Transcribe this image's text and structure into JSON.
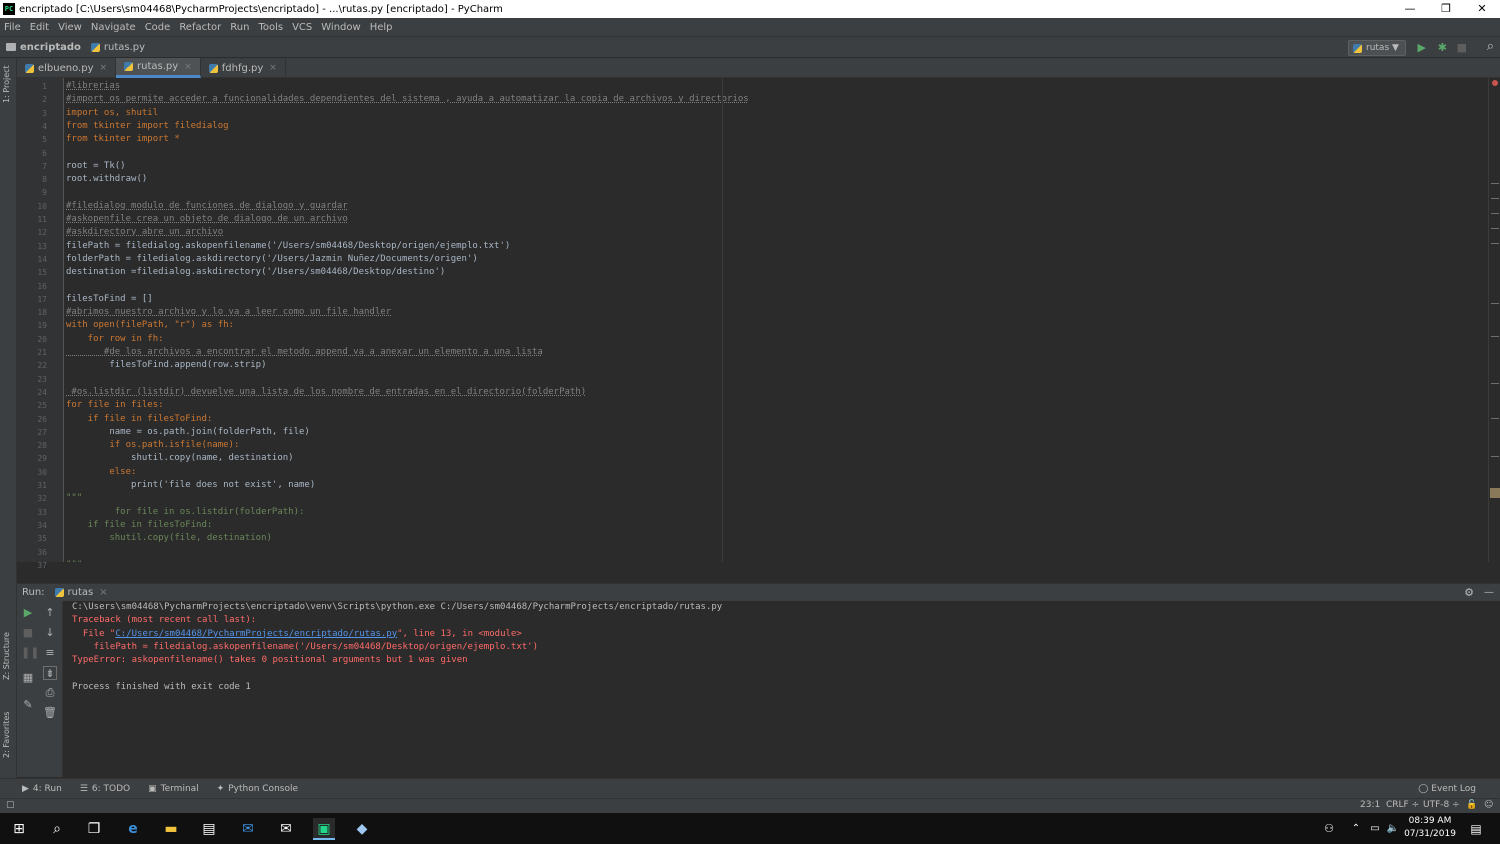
{
  "window": {
    "title": "encriptado [C:\\Users\\sm04468\\PycharmProjects\\encriptado] - ...\\rutas.py [encriptado] - PyCharm",
    "app_icon_text": "PC",
    "minimize": "—",
    "restore": "❐",
    "close": "✕"
  },
  "menu": [
    "File",
    "Edit",
    "View",
    "Navigate",
    "Code",
    "Refactor",
    "Run",
    "Tools",
    "VCS",
    "Window",
    "Help"
  ],
  "nav": {
    "project": "encriptado",
    "file": "rutas.py",
    "run_config": "rutas ▼",
    "run": "▶",
    "debug": "✱",
    "stop": "■",
    "search": "⌕"
  },
  "left_strip": {
    "project": "1: Project",
    "structure": "Z: Structure",
    "favorites": "2: Favorites"
  },
  "tabs": [
    {
      "label": "elbueno.py",
      "close": "×"
    },
    {
      "label": "rutas.py",
      "close": "×"
    },
    {
      "label": "fdhfg.py",
      "close": "×"
    }
  ],
  "line_numbers": [
    "1",
    "2",
    "3",
    "4",
    "5",
    "6",
    "7",
    "8",
    "9",
    "10",
    "11",
    "12",
    "13",
    "14",
    "15",
    "16",
    "17",
    "18",
    "19",
    "20",
    "21",
    "22",
    "23",
    "24",
    "25",
    "26",
    "27",
    "28",
    "29",
    "30",
    "31",
    "32",
    "33",
    "34",
    "35",
    "36",
    "37"
  ],
  "code": [
    "#librerias",
    "#import os permite acceder a funcionalidades dependientes del sistema , ayuda a automatizar la copia de archivos y directorios",
    "import os, shutil",
    "from tkinter import filedialog",
    "from tkinter import *",
    "",
    "root = Tk()",
    "root.withdraw()",
    "",
    "#filedialog modulo de funciones de dialogo y guardar",
    "#askopenfile crea un objeto de dialogo de un archivo",
    "#askdirectory abre un archivo",
    "filePath = filedialog.askopenfilename('/Users/sm04468/Desktop/origen/ejemplo.txt')",
    "folderPath = filedialog.askdirectory('/Users/Jazmin Nuñez/Documents/origen')",
    "destination =filedialog.askdirectory('/Users/sm04468/Desktop/destino')",
    "",
    "filesToFind = []",
    "#abrimos nuestro archivo y lo va a leer como un file handler",
    "with open(filePath, \"r\") as fh:",
    "    for row in fh:",
    "       #de los archivos a encontrar el metodo append va a anexar un elemento a una lista",
    "        filesToFind.append(row.strip)",
    "",
    " #os.listdir (listdir) devuelve una lista de los nombre de entradas en el directorio(folderPath)",
    "for file in files:",
    "    if file in filesToFind:",
    "        name = os.path.join(folderPath, file)",
    "        if os.path.isfile(name):",
    "            shutil.copy(name, destination)",
    "        else:",
    "            print('file does not exist', name)",
    "\"\"\"",
    "         for file in os.listdir(folderPath):",
    "    if file in filesToFind:",
    "        shutil.copy(file, destination)",
    "",
    "\"\"\""
  ],
  "run_panel": {
    "label": "Run:",
    "tab": "rutas",
    "tab_close": "×",
    "settings": "⚙",
    "minimize": "—",
    "output": {
      "cmd": "C:\\Users\\sm04468\\PycharmProjects\\encriptado\\venv\\Scripts\\python.exe C:/Users/sm04468/PycharmProjects/encriptado/rutas.py",
      "tb": "Traceback (most recent call last):",
      "file_pre": "  File \"",
      "file_link": "C:/Users/sm04468/PycharmProjects/encriptado/rutas.py",
      "file_post": "\", line 13, in <module>",
      "src": "    filePath = filedialog.askopenfilename('/Users/sm04468/Desktop/origen/ejemplo.txt')",
      "err": "TypeError: askopenfilename() takes 0 positional arguments but 1 was given",
      "blank": "",
      "exit": "Process finished with exit code 1"
    }
  },
  "bottom_tools": [
    "4: Run",
    "6: TODO",
    "Terminal",
    "Python Console"
  ],
  "event_log": "Event Log",
  "status": {
    "position": "23:1",
    "line_sep": "CRLF ÷",
    "encoding": "UTF-8 ÷"
  },
  "taskbar": {
    "time": "08:39 AM",
    "date": "07/31/2019"
  },
  "colors": {
    "accent": "#4a88c7",
    "error": "#ff6b68",
    "keyword": "#cc7832",
    "string": "#6a8759",
    "comment": "#808080",
    "run_green": "#59a869"
  }
}
